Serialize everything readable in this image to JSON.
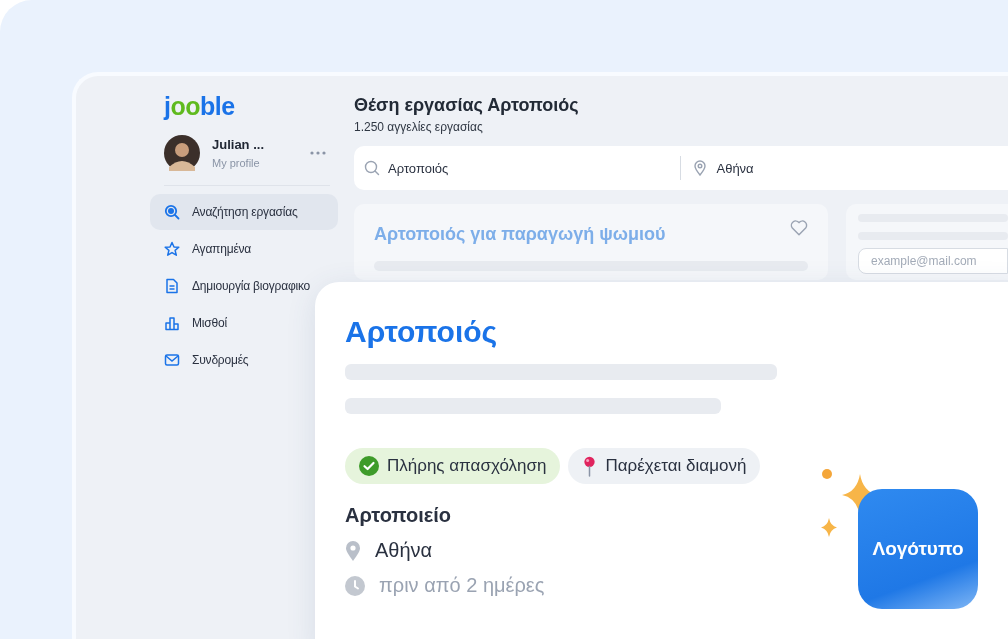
{
  "brand": {
    "name": "jooble"
  },
  "profile": {
    "name": "Julian ...",
    "link": "My profile"
  },
  "nav": [
    {
      "label": "Αναζήτηση εργασίας",
      "kind": "search",
      "selected": true
    },
    {
      "label": "Αγαπημένα",
      "kind": "favorites",
      "selected": false
    },
    {
      "label": "Δημιουργία βιογραφικο",
      "kind": "resume",
      "selected": false
    },
    {
      "label": "Μισθοί",
      "kind": "salaries",
      "selected": false
    },
    {
      "label": "Συνδρομές",
      "kind": "subscriptions",
      "selected": false
    }
  ],
  "header": {
    "title": "Θέση εργασίας Αρτοποιός",
    "count": "1.250 αγγελίες εργασίας"
  },
  "search": {
    "query": "Αρτοποιός",
    "location": "Αθήνα"
  },
  "listing": {
    "title": "Αρτοποιός για παραγωγή ψωμιού",
    "saved": false
  },
  "subscribe": {
    "placeholder": "example@mail.com"
  },
  "featured": {
    "title": "Αρτοποιός",
    "tags": [
      {
        "label": "Πλήρης απασχόληση",
        "kind": "check"
      },
      {
        "label": "Παρέχεται διαμονή",
        "kind": "pin"
      }
    ],
    "company": "Αρτοποιείο",
    "location": "Αθήνα",
    "posted": "πριν από 2 ημέρες",
    "logo": "Λογότυπο"
  }
}
